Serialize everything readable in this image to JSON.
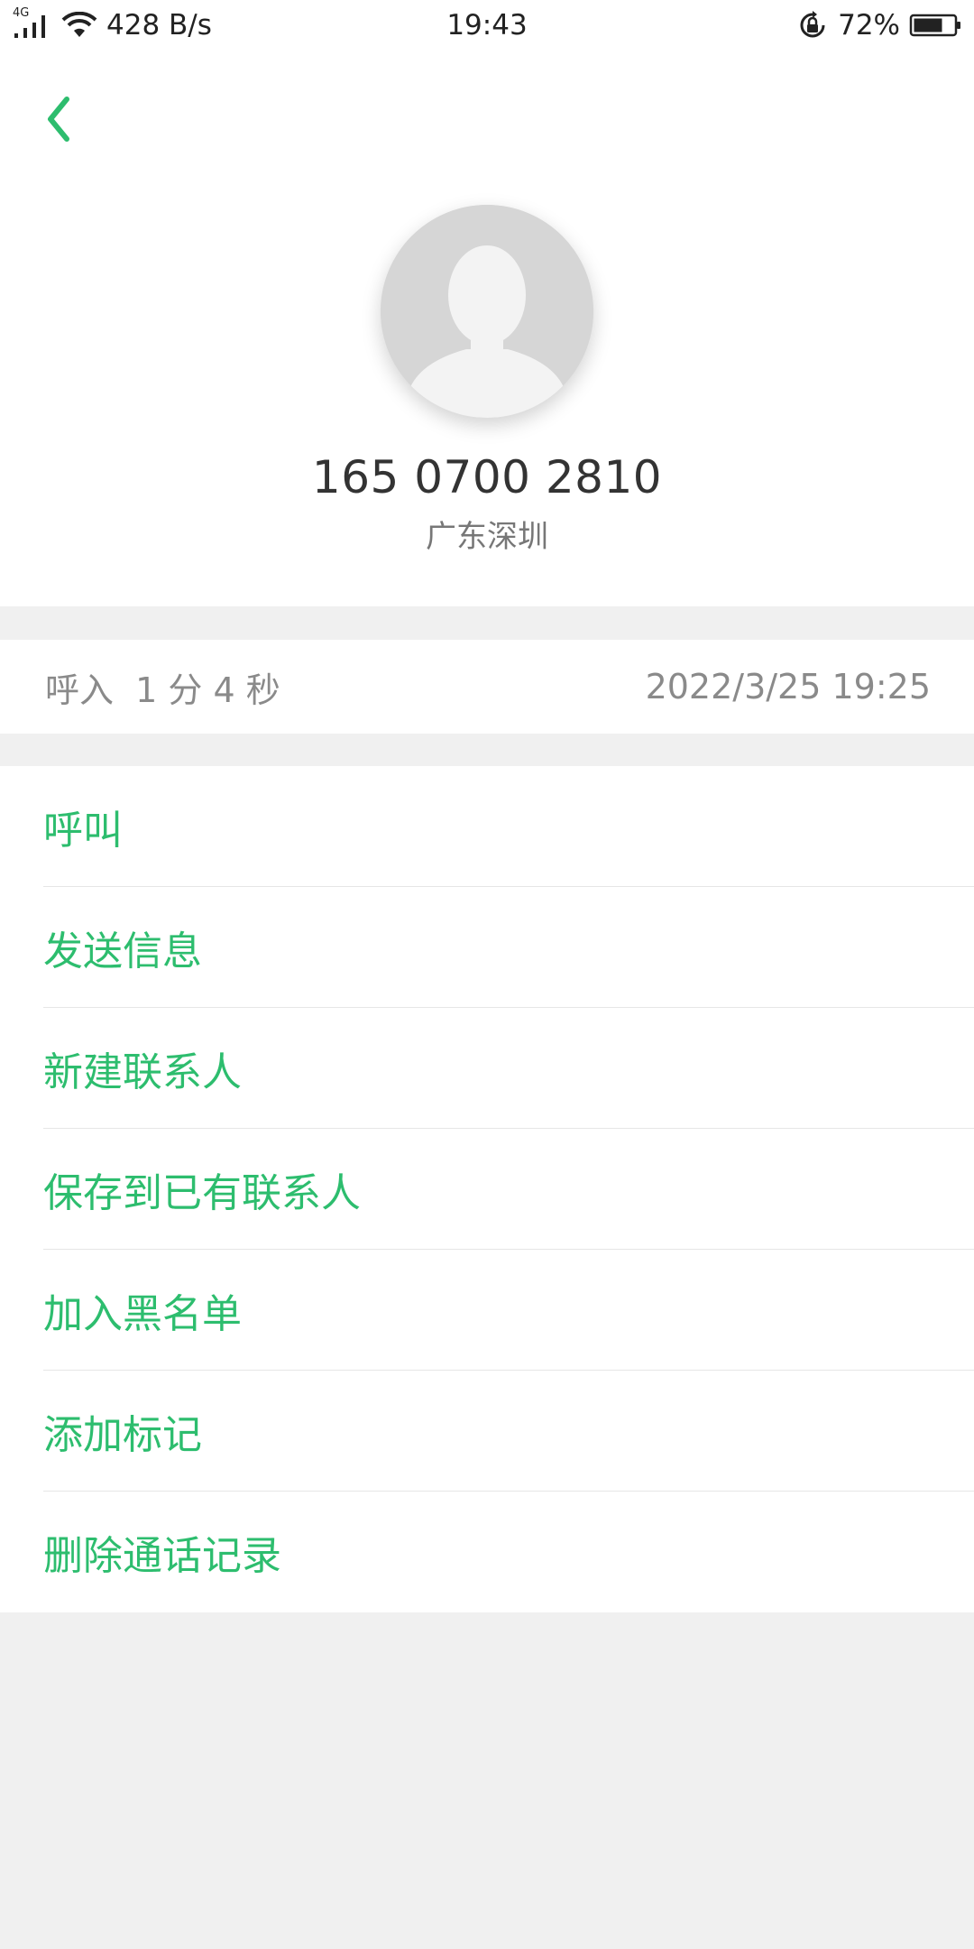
{
  "status_bar": {
    "network": "4G",
    "speed": "428 B/s",
    "time": "19:43",
    "battery": "72%",
    "battery_level": 0.72
  },
  "contact": {
    "phone_number": "165 0700 2810",
    "location": "广东深圳"
  },
  "call_record": {
    "type_duration": "呼入  1 分 4 秒",
    "datetime": "2022/3/25 19:25"
  },
  "actions": [
    {
      "label": "呼叫"
    },
    {
      "label": "发送信息"
    },
    {
      "label": "新建联系人"
    },
    {
      "label": "保存到已有联系人"
    },
    {
      "label": "加入黑名单"
    },
    {
      "label": "添加标记"
    },
    {
      "label": "删除通话记录"
    }
  ],
  "colors": {
    "accent": "#2dbd6e",
    "background": "#f0f0f0",
    "card": "#ffffff",
    "secondary_text": "#8a8a8a"
  },
  "icons": {
    "back": "chevron-left-icon",
    "avatar": "default-person-avatar",
    "signal": "signal-icon",
    "wifi": "wifi-icon",
    "rotation_lock": "rotation-lock-icon",
    "battery": "battery-icon"
  }
}
